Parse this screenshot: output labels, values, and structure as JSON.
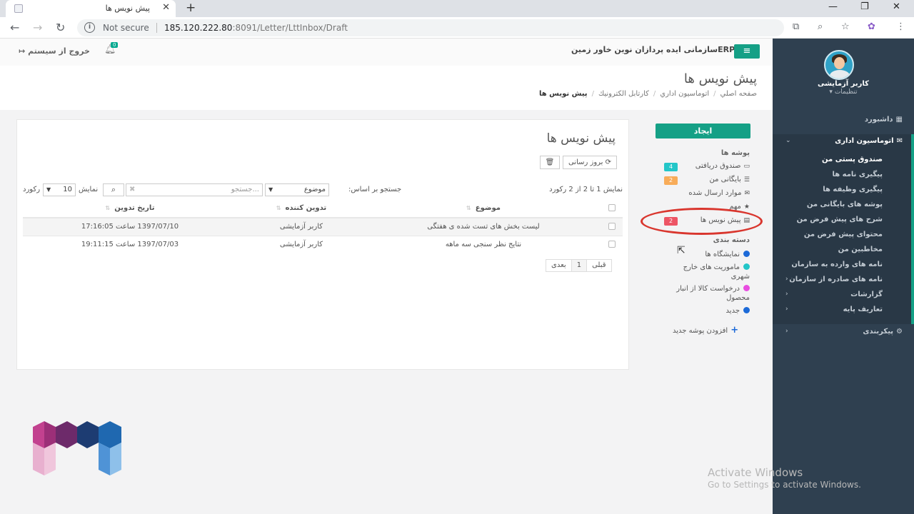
{
  "browser": {
    "tab_title": "پیش نویس ها",
    "not_secure": "Not secure",
    "url_host": "185.120.222.80",
    "url_path": ":8091/Letter/LttInbox/Draft"
  },
  "header": {
    "company": "ERPسازمانی ایده پردازان نوین خاور زمین",
    "logout": "خروج از سیستم",
    "notification_count": "0"
  },
  "page": {
    "title": "پیش نویس ها",
    "breadcrumb": [
      "صفحه اصلي",
      "اتوماسيون اداري",
      "كارتابل الكترونيك",
      "پیش نویس ها"
    ]
  },
  "panel": {
    "create_label": "ایجاد",
    "folders_header": "پوشه ها",
    "folders": [
      {
        "label": "صندوق دریافتی",
        "badge": "4",
        "badge_color": "#23c6c8"
      },
      {
        "label": "بایگانی من",
        "badge": "2",
        "badge_color": "#f8ac59"
      },
      {
        "label": "موارد ارسال شده",
        "badge": "",
        "badge_color": ""
      },
      {
        "label": "مهم",
        "badge": "",
        "badge_color": ""
      },
      {
        "label": "پیش نویس ها",
        "badge": "2",
        "badge_color": "#ed5565"
      }
    ],
    "categories_header": "دسته بندی",
    "categories": [
      {
        "label": "نمایشگاه ها",
        "color": "#1c6ad8"
      },
      {
        "label": "ماموریت های خارج شهری",
        "color": "#23c6c8"
      },
      {
        "label": "درخواست کالا از انبار محصول",
        "color": "#e84ce0"
      },
      {
        "label": "جدید",
        "color": "#1c6ad8"
      }
    ],
    "add_folder": "افزودن پوشه جدید"
  },
  "list": {
    "title": "پیش نویس ها",
    "refresh_label": "بروز رسانی",
    "records_info": "نمایش 1 تا 2 از 2 رکورد",
    "search_by_label": "جستجو بر اساس:",
    "search_field_value": "موضوع",
    "search_placeholder": "جستجو...",
    "show_label": "نمایش",
    "page_size": "10",
    "records_label": "رکورد",
    "columns": [
      "موضوع",
      "تدوین کننده",
      "تاریخ تدوین"
    ],
    "rows": [
      {
        "subject": "لیست بخش های تست شده ی هفتگی",
        "author": "کاربر آزمایشی",
        "date": "1397/07/10 ساعت 17:16:05"
      },
      {
        "subject": "نتایج نظر سنجی سه ماهه",
        "author": "کاربر آزمایشی",
        "date": "1397/07/03 ساعت 19:11:15"
      }
    ],
    "pager": {
      "prev": "قبلی",
      "current": "1",
      "next": "بعدی"
    }
  },
  "sidebar": {
    "user_name": "کاربر آزمایشی",
    "settings": "تنظیمات",
    "dashboard": "داشبورد",
    "automation": "اتوماسیون اداری",
    "sub_items": [
      "صندوق پستی من",
      "پیگیری نامه ها",
      "پیگیری وظیفه ها",
      "پوشه های بایگانی من",
      "شرح های پیش فرض من",
      "محتوای پیش فرض من",
      "مخاطبین من",
      "نامه های وارده به سازمان",
      "نامه های صادره از سازمان",
      "گزارشات",
      "تعاریف پایه"
    ],
    "config": "پیکربندی"
  },
  "watermark": {
    "line1": "Activate Windows",
    "line2": "Go to Settings to activate Windows."
  },
  "colors": {
    "brand": "#15a086",
    "sidebar": "#2f4050",
    "highlight": "#d9362e"
  }
}
